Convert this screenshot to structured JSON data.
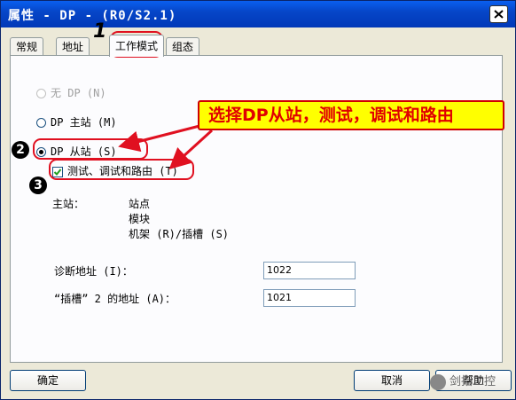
{
  "window": {
    "title": "属性 - DP - (R0/S2.1)"
  },
  "tabs": [
    {
      "label": "常规"
    },
    {
      "label": "地址"
    },
    {
      "label": "工作模式"
    },
    {
      "label": "组态"
    }
  ],
  "modes": {
    "no_dp": "无 DP (N)",
    "dp_master": "DP 主站 (M)",
    "dp_slave": "DP 从站 (S)",
    "test_option": "测试、调试和路由 (T)"
  },
  "master_info": {
    "label": "主站：",
    "station": "站点",
    "module": "模块",
    "rack_slot": "机架 (R)/插槽 (S)"
  },
  "fields": {
    "diag_label": "诊断地址 (I)：",
    "diag_value": "1022",
    "slot2_label": "“插槽” 2 的地址 (A)：",
    "slot2_value": "1021"
  },
  "buttons": {
    "ok": "确定",
    "cancel": "取消",
    "help": "帮助"
  },
  "annotation": {
    "callout": "选择DP从站，测试，调试和路由",
    "step1": "1",
    "step2": "2",
    "step3": "3",
    "highlight_color": "#e01020",
    "callout_bg": "#ffff00"
  },
  "watermark": {
    "text": "剑指工控"
  },
  "colors": {
    "titlebar": "#0646c8",
    "dialog_bg": "#ece9d8"
  }
}
